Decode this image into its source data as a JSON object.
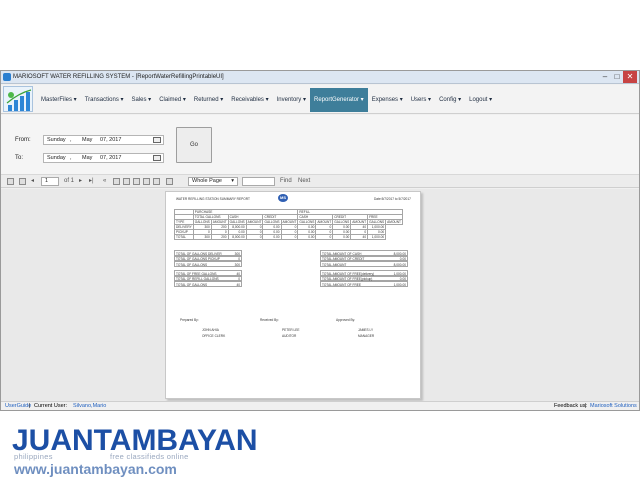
{
  "window": {
    "title": "MARIOSOFT WATER REFILLING SYSTEM - [ReportWaterRefillingPrintableUI]",
    "min_icon": "minimize-icon",
    "max_icon": "maximize-icon",
    "close_icon": "close-icon"
  },
  "menu": {
    "items": [
      {
        "label": "MasterFiles ▾"
      },
      {
        "label": "Transactions ▾"
      },
      {
        "label": "Sales ▾"
      },
      {
        "label": "Claimed ▾"
      },
      {
        "label": "Returned ▾"
      },
      {
        "label": "Receivables ▾"
      },
      {
        "label": "Inventory ▾"
      },
      {
        "label": "ReportGenerator ▾"
      },
      {
        "label": "Expenses ▾"
      },
      {
        "label": "Users ▾"
      },
      {
        "label": "Config ▾"
      },
      {
        "label": "Logout ▾"
      }
    ],
    "active_index": 7,
    "active_color": "#3e7e9a"
  },
  "filter": {
    "from_label": "From:",
    "to_label": "To:",
    "from": {
      "day": "Sunday",
      "sep": ",",
      "month": "May",
      "date": "07, 2017"
    },
    "to": {
      "day": "Sunday",
      "sep": ",",
      "month": "May",
      "date": "07, 2017"
    },
    "go_label": "Go"
  },
  "report_toolbar": {
    "page_value": "1",
    "page_of": "of 1",
    "zoom": "Whole Page",
    "find": "Find",
    "next": "Next"
  },
  "report": {
    "title": "WATER REFILLING STATION SUMMARY REPORT",
    "date": "Date:5/7/2017 to 5/7/2017",
    "logo_text": "MS",
    "group_headers": [
      "PURCHASE",
      "REFILL"
    ],
    "sub_headers": [
      "TOTAL GALLONS",
      "CASH",
      "CREDIT",
      "CASH",
      "CREDIT",
      "FREE"
    ],
    "col_headers": [
      "TYPE",
      "GALLONS",
      "AMOUNT",
      "GALLONS",
      "AMOUNT",
      "GALLONS",
      "AMOUNT",
      "GALLONS",
      "AMOUNT",
      "GALLONS",
      "AMOUNT",
      "GALLONS",
      "AMOUNT"
    ],
    "rows": [
      [
        "DELIVERY",
        "300",
        "200",
        "8,000.00",
        "0",
        "0.00",
        "0",
        "0.00",
        "0",
        "0.00",
        "40",
        "1,000.00"
      ],
      [
        "PICKUP",
        "0",
        "0",
        "0.00",
        "0",
        "0.00",
        "0",
        "0.00",
        "0",
        "0.00",
        "0",
        "0.00"
      ],
      [
        "TOTAL",
        "300",
        "200",
        "8,000.00",
        "0",
        "0.00",
        "0",
        "0.00",
        "0",
        "0.00",
        "40",
        "1,000.00"
      ]
    ],
    "left_summary": [
      {
        "label": "TOTAL OF GALLONS DELIVER",
        "value": "300"
      },
      {
        "label": "TOTAL OF GALLONS PICKUP",
        "value": "0"
      },
      {
        "label": "TOTAL OF GALLONS",
        "value": "300"
      },
      {
        "label": "TOTAL OF FREE GALLONS",
        "value": "40"
      },
      {
        "label": "TOTAL OF REFILL GALLONS",
        "value": "0"
      },
      {
        "label": "TOTAL OF GALLONS",
        "value": "40"
      }
    ],
    "right_summary": [
      {
        "label": "TOTAL AMOUNT OF CASH",
        "value": "8,000.00"
      },
      {
        "label": "TOTAL AMOUNT OF CREDIT",
        "value": "0.00"
      },
      {
        "label": "TOTAL AMOUNT",
        "value": "8,000.00"
      },
      {
        "label": "TOTAL AMOUNT OF FREE(delivery)",
        "value": "1,000.00"
      },
      {
        "label": "TOTAL AMOUNT OF FREE(pickup)",
        "value": "0.00"
      },
      {
        "label": "TOTAL AMOUNT OF FREE",
        "value": "1,000.00"
      }
    ],
    "signatures": [
      {
        "role": "Prepared By:",
        "name": "JOHN AHIA",
        "title": "OFFICE CLERK"
      },
      {
        "role": "Received By:",
        "name": "PETER LEE",
        "title": "AUDITOR"
      },
      {
        "role": "Approved By:",
        "name": "JAMES LY",
        "title": "MANAGER"
      }
    ]
  },
  "status": {
    "usergude": "UserGuide",
    "current_user_label": "Current User:",
    "current_user": "Silvano,Mario",
    "feedback": "Feedback us:",
    "company": "Mariosoft Solutions"
  },
  "watermark": {
    "logo": "JUANTAMBAYAN",
    "sub1": "philippines",
    "sub2": "free classifieds online",
    "url": "www.juantambayan.com"
  }
}
